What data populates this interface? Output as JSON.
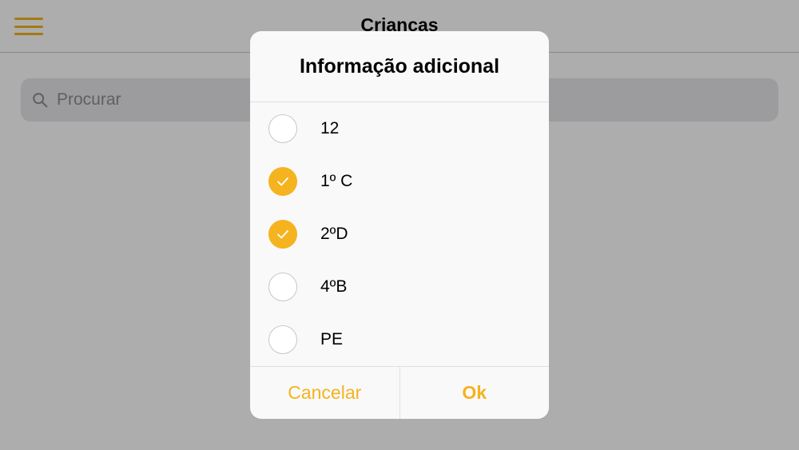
{
  "colors": {
    "accent": "#F5B320"
  },
  "navbar": {
    "title": "Crianças",
    "menu_icon": "hamburger-menu-icon"
  },
  "search": {
    "placeholder": "Procurar",
    "icon": "search-icon"
  },
  "dialog": {
    "title": "Informação adicional",
    "options": [
      {
        "label": "12",
        "checked": false
      },
      {
        "label": "1º C",
        "checked": true
      },
      {
        "label": "2ºD",
        "checked": true
      },
      {
        "label": "4ºB",
        "checked": false
      },
      {
        "label": "PE",
        "checked": false
      }
    ],
    "cancel_label": "Cancelar",
    "ok_label": "Ok"
  }
}
